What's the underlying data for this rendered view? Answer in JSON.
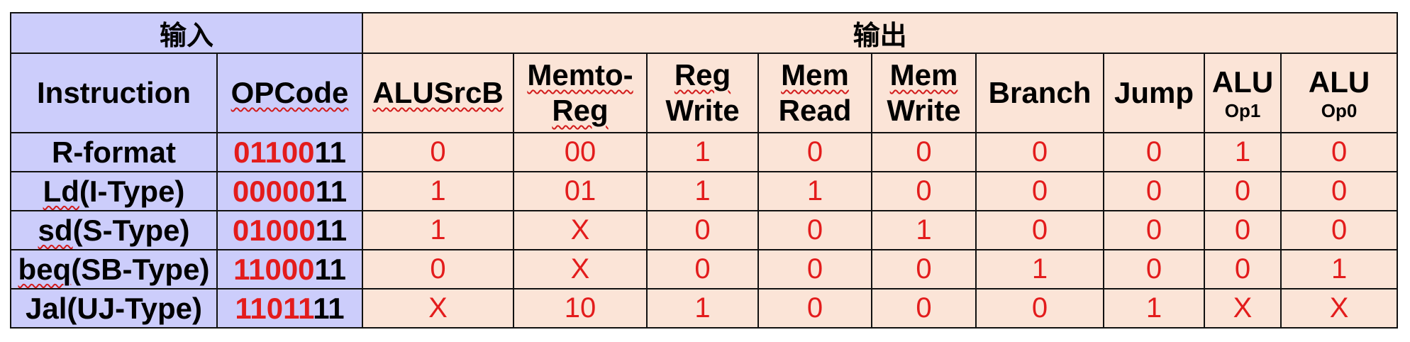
{
  "groups": {
    "input": "输入",
    "output": "输出"
  },
  "headers": {
    "instruction": "Instruction",
    "opcode": "OPCode",
    "alusrcb": "ALUSrcB",
    "memtoreg_1": "Memto-",
    "memtoreg_2": "Reg",
    "regwrite_1": "Reg",
    "regwrite_2": "Write",
    "memread_1": "Mem",
    "memread_2": "Read",
    "memwrite_1": "Mem",
    "memwrite_2": "Write",
    "branch": "Branch",
    "jump": "Jump",
    "aluop1_1": "ALU",
    "aluop1_2": "Op1",
    "aluop0_1": "ALU",
    "aluop0_2": "Op0"
  },
  "rows": [
    {
      "instr_pre": "",
      "instr_ul": "",
      "instr_post": "R-format",
      "op_red": "01100",
      "op_black": "11",
      "alusrcb": "0",
      "memtoreg": "00",
      "regwrite": "1",
      "memread": "0",
      "memwrite": "0",
      "branch": "0",
      "jump": "0",
      "aluop1": "1",
      "aluop0": "0"
    },
    {
      "instr_pre": "",
      "instr_ul": "Ld",
      "instr_post": "(I-Type)",
      "op_red": "00000",
      "op_black": "11",
      "alusrcb": "1",
      "memtoreg": "01",
      "regwrite": "1",
      "memread": "1",
      "memwrite": "0",
      "branch": "0",
      "jump": "0",
      "aluop1": "0",
      "aluop0": "0"
    },
    {
      "instr_pre": "",
      "instr_ul": "sd",
      "instr_post": "(S-Type)",
      "op_red": "01000",
      "op_black": "11",
      "alusrcb": "1",
      "memtoreg": "X",
      "regwrite": "0",
      "memread": "0",
      "memwrite": "1",
      "branch": "0",
      "jump": "0",
      "aluop1": "0",
      "aluop0": "0"
    },
    {
      "instr_pre": "",
      "instr_ul": "beq",
      "instr_post": "(SB-Type)",
      "op_red": "11000",
      "op_black": "11",
      "alusrcb": "0",
      "memtoreg": "X",
      "regwrite": "0",
      "memread": "0",
      "memwrite": "0",
      "branch": "1",
      "jump": "0",
      "aluop1": "0",
      "aluop0": "1"
    },
    {
      "instr_pre": "",
      "instr_ul": "",
      "instr_post": "Jal(UJ-Type)",
      "op_red": "11011",
      "op_black": "11",
      "alusrcb": "X",
      "memtoreg": "10",
      "regwrite": "1",
      "memread": "0",
      "memwrite": "0",
      "branch": "0",
      "jump": "1",
      "aluop1": "X",
      "aluop0": "X"
    }
  ]
}
